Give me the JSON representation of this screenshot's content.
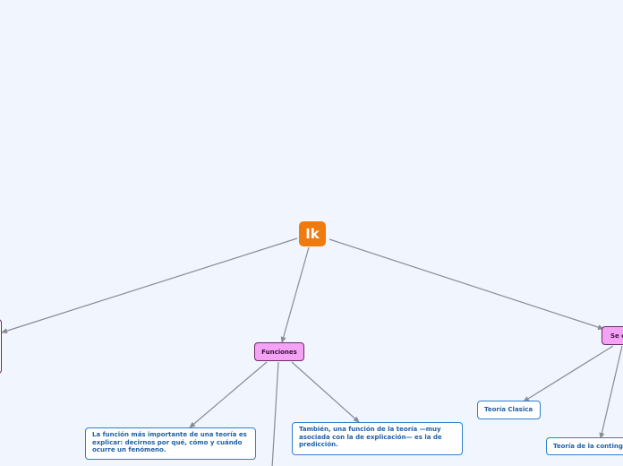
{
  "root": {
    "label": "Ik",
    "color": "#ee7a10"
  },
  "topics": {
    "funciones": "Funciones",
    "se_clasifican": "Se c"
  },
  "leaves": {
    "funcion_importante": "La función más importante de una teoría es explicar: decirnos por qué, cómo y cuándo ocurre un fenómeno.",
    "funcion_prediccion": "También, una función de la teoría —muy asociada con la de explicación— es la de predicción.",
    "teoria_clasica": "Teoría Clasica",
    "teoria_contingencia": "Teoría de la conting"
  },
  "colors": {
    "background": "#f1f5fd",
    "connector": "#8a8a96",
    "topic_fill": "#f4a3f4",
    "leaf_border": "#2f7fcf"
  }
}
